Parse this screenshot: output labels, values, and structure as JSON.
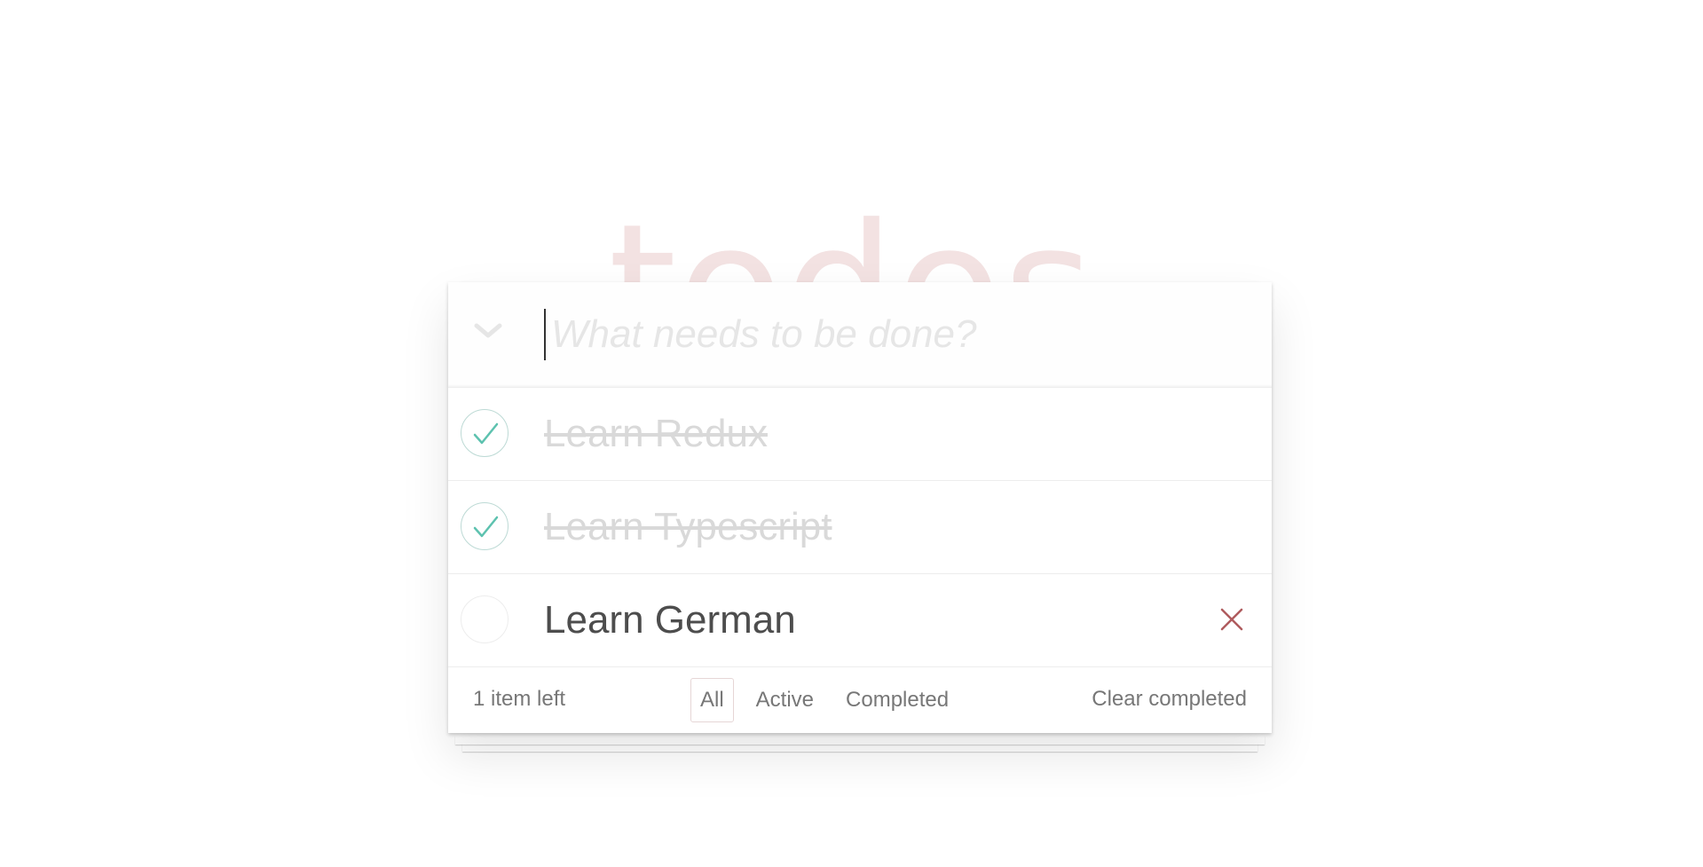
{
  "app": {
    "title": "todos"
  },
  "input": {
    "placeholder": "What needs to be done?",
    "value": ""
  },
  "todos": [
    {
      "label": "Learn Redux",
      "completed": true
    },
    {
      "label": "Learn Typescript",
      "completed": true
    },
    {
      "label": "Learn German",
      "completed": false
    }
  ],
  "footer": {
    "count_text": "1 item left",
    "filters": [
      {
        "label": "All",
        "selected": true
      },
      {
        "label": "Active",
        "selected": false
      },
      {
        "label": "Completed",
        "selected": false
      }
    ],
    "clear_label": "Clear completed"
  },
  "icons": {
    "toggle_all": "chevron-down-icon",
    "check": "checkmark-icon",
    "destroy": "close-icon"
  },
  "colors": {
    "title": "#f3e2e2",
    "check_mark": "#5dc2af",
    "destroy": "#af5b5e"
  }
}
